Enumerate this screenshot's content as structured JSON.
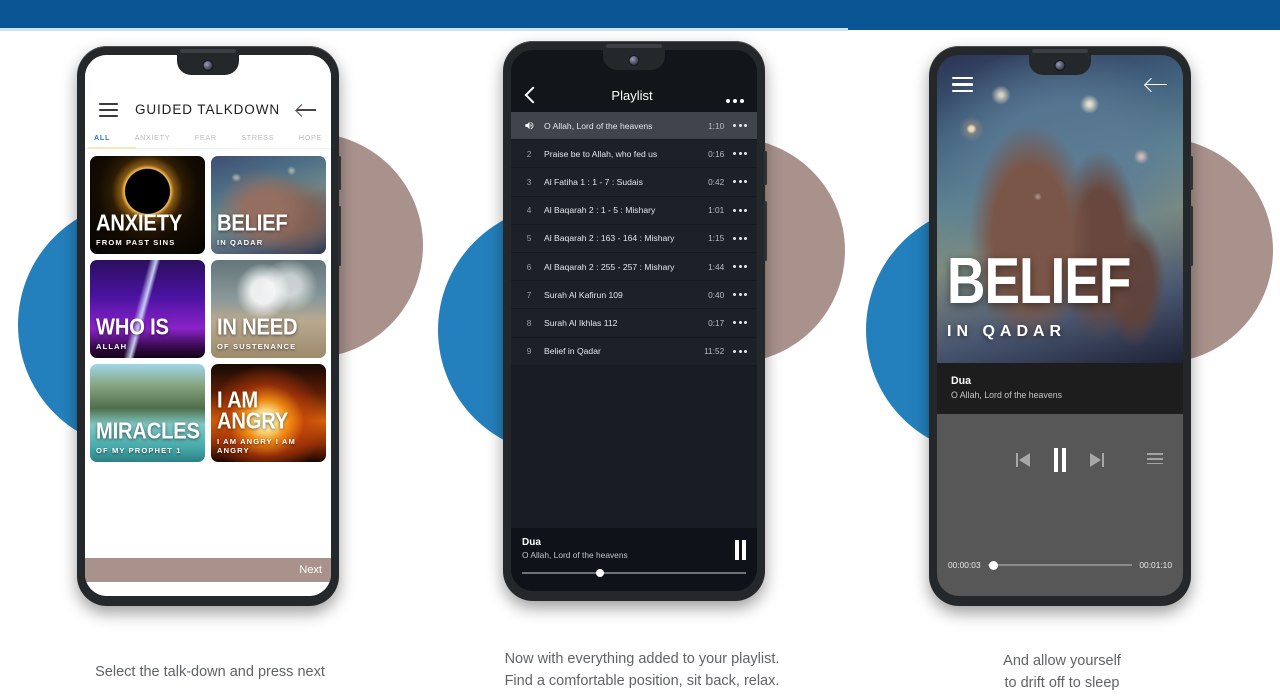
{
  "colors": {
    "topbar_blue": "#0a5694",
    "circle_blue": "#2480bd",
    "circle_mauve": "#a9918c",
    "accent_tab": "#2d7fc6",
    "next_bar": "#a9918c"
  },
  "phone1": {
    "menu_icon": "hamburger-icon",
    "title": "GUIDED TALKDOWN",
    "back_icon": "back-arrow-icon",
    "tabs": [
      {
        "label": "ALL",
        "active": true
      },
      {
        "label": "ANXIETY",
        "active": false
      },
      {
        "label": "FEAR",
        "active": false
      },
      {
        "label": "STRESS",
        "active": false
      },
      {
        "label": "HOPE",
        "active": false
      }
    ],
    "cards": [
      {
        "title": "ANXIETY",
        "subtitle": "FROM PAST SINS",
        "art": "art-anxiety"
      },
      {
        "title": "BELIEF",
        "subtitle": "IN QADAR",
        "art": "art-belief"
      },
      {
        "title": "WHO IS",
        "subtitle": "ALLAH",
        "art": "art-whois"
      },
      {
        "title": "IN NEED",
        "subtitle": "OF SUSTENANCE",
        "art": "art-inneed"
      },
      {
        "title": "MIRACLES",
        "subtitle": "OF MY PROPHET 1",
        "art": "art-miracles"
      },
      {
        "title": "I AM ANGRY",
        "subtitle": "I AM ANGRY I AM ANGRY",
        "art": "art-angry"
      }
    ],
    "next_label": "Next",
    "caption": "Select the talk-down and press next"
  },
  "phone2": {
    "back_icon": "chevron-left-icon",
    "title": "Playlist",
    "overflow_icon": "more-options-icon",
    "tracks": [
      {
        "num": "",
        "name": "O Allah, Lord of the heavens",
        "duration": "1:10",
        "playing": true
      },
      {
        "num": "2",
        "name": "Praise be to Allah, who fed us",
        "duration": "0:16",
        "playing": false
      },
      {
        "num": "3",
        "name": "Al Fatiha 1 : 1 - 7 : Sudais",
        "duration": "0:42",
        "playing": false
      },
      {
        "num": "4",
        "name": "Al Baqarah 2 : 1 - 5 : Mishary",
        "duration": "1:01",
        "playing": false
      },
      {
        "num": "5",
        "name": "Al Baqarah 2 : 163 - 164 : Mishary",
        "duration": "1:15",
        "playing": false
      },
      {
        "num": "6",
        "name": "Al Baqarah 2 : 255 - 257 : Mishary",
        "duration": "1:44",
        "playing": false
      },
      {
        "num": "7",
        "name": "Surah Al Kafirun 109",
        "duration": "0:40",
        "playing": false
      },
      {
        "num": "8",
        "name": "Surah Al Ikhlas 112",
        "duration": "0:17",
        "playing": false
      },
      {
        "num": "9",
        "name": "Belief in Qadar",
        "duration": "11:52",
        "playing": false
      }
    ],
    "player": {
      "title": "Dua",
      "subtitle": "O Allah, Lord of the heavens",
      "pause_icon": "pause-icon",
      "progress_percent": 33
    },
    "caption_line1": "Now with everything added to your playlist.",
    "caption_line2": "Find a comfortable position, sit back, relax."
  },
  "phone3": {
    "menu_icon": "hamburger-icon",
    "back_icon": "back-arrow-icon",
    "artwork_title": "BELIEF",
    "artwork_subtitle": "IN QADAR",
    "now_playing": {
      "title": "Dua",
      "subtitle": "O Allah, Lord of the heavens"
    },
    "controls": {
      "previous_icon": "skip-previous-icon",
      "pause_icon": "pause-icon",
      "next_icon": "skip-next-icon",
      "queue_icon": "playlist-queue-icon"
    },
    "elapsed": "00:00:03",
    "total": "00:01:10",
    "progress_percent": 4,
    "caption_line1": "And allow yourself",
    "caption_line2": "to drift off to sleep"
  }
}
